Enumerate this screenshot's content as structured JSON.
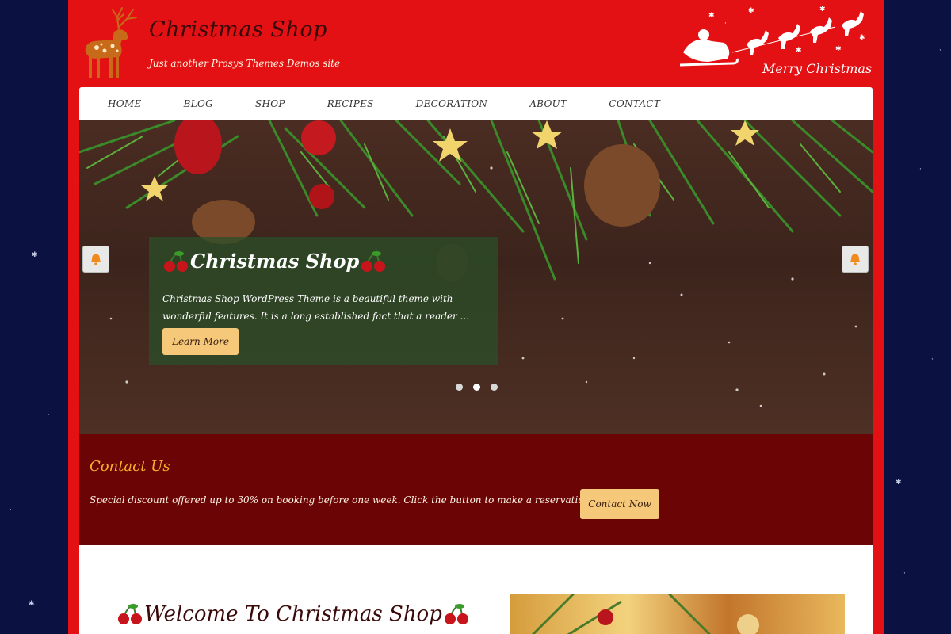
{
  "header": {
    "site_title": "Christmas Shop",
    "tagline": "Just another Prosys Themes Demos site",
    "banner_text": "Merry Christmas"
  },
  "nav": {
    "items": [
      {
        "label": "HOME"
      },
      {
        "label": "BLOG"
      },
      {
        "label": "SHOP"
      },
      {
        "label": "RECIPES"
      },
      {
        "label": "DECORATION"
      },
      {
        "label": "ABOUT"
      },
      {
        "label": "CONTACT"
      }
    ]
  },
  "slider": {
    "title": "Christmas Shop",
    "text": "Christmas Shop WordPress Theme is a beautiful theme with wonderful features. It is a long established fact that a reader ...",
    "button_label": "Learn More",
    "prev_icon": "bell-icon",
    "next_icon": "bell-icon",
    "slide_count": 3,
    "active_slide": 1
  },
  "contact": {
    "title": "Contact Us",
    "text": "Special discount offered up to  30% on booking before one week. Click the button to make a reservation.",
    "button_label": "Contact Now"
  },
  "welcome": {
    "title": "Welcome To Christmas Shop"
  },
  "colors": {
    "frame_red": "#e31114",
    "night_blue": "#0b1140",
    "contact_band": "#6b0404",
    "button_gold": "#f6c97a",
    "accent_orange": "#f6b02b"
  }
}
